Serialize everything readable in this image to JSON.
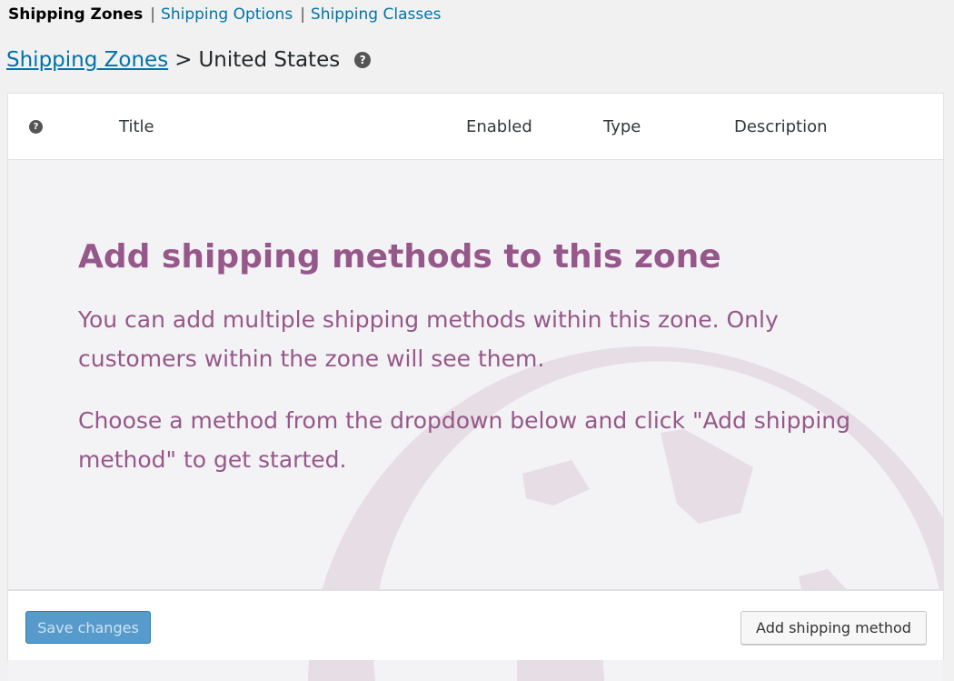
{
  "subnav": {
    "current": "Shipping Zones",
    "links": [
      "Shipping Options",
      "Shipping Classes"
    ],
    "separator": "|"
  },
  "breadcrumb": {
    "parent": "Shipping Zones",
    "separator": ">",
    "current": "United States",
    "help_glyph": "?"
  },
  "table": {
    "help_glyph": "?",
    "columns": [
      "Title",
      "Enabled",
      "Type",
      "Description"
    ]
  },
  "blank_state": {
    "title": "Add shipping methods to this zone",
    "paragraphs": [
      "You can add multiple shipping methods within this zone. Only customers within the zone will see them.",
      "Choose a method from the dropdown below and click \"Add shipping method\" to get started."
    ],
    "background_icon": "globe-icon"
  },
  "footer": {
    "save_label": "Save changes",
    "add_label": "Add shipping method"
  },
  "colors": {
    "link": "#0073aa",
    "accent_purple": "#96588a",
    "primary_button": "#569bcb"
  }
}
